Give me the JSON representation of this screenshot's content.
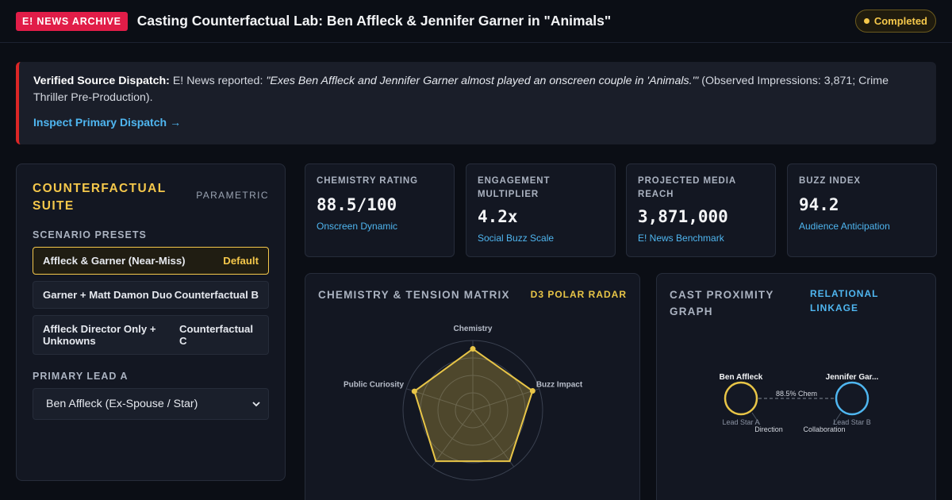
{
  "header": {
    "badge": "E! NEWS ARCHIVE",
    "title": "Casting Counterfactual Lab: Ben Affleck & Jennifer Garner in \"Animals\"",
    "status": "Completed"
  },
  "dispatch": {
    "label": "Verified Source Dispatch:",
    "lead": "E! News reported:",
    "quote": "\"Exes Ben Affleck and Jennifer Garner almost played an onscreen couple in 'Animals.'\"",
    "tail": "(Observed Impressions: 3,871; Crime Thriller Pre-Production).",
    "link_label": "Inspect Primary Dispatch",
    "link_arrow": "→"
  },
  "suite": {
    "title": "COUNTERFACTUAL SUITE",
    "tag": "PARAMETRIC",
    "presets_label": "SCENARIO PRESETS",
    "presets": [
      {
        "name": "Affleck & Garner (Near-Miss)",
        "tag": "Default",
        "active": true
      },
      {
        "name": "Garner + Matt Damon Duo",
        "tag": "Counterfactual B",
        "active": false
      },
      {
        "name": "Affleck Director Only + Unknowns",
        "tag": "Counterfactual C",
        "active": false
      }
    ],
    "lead_label": "PRIMARY LEAD A",
    "lead_value": "Ben Affleck (Ex-Spouse / Star)"
  },
  "kpis": [
    {
      "label": "CHEMISTRY RATING",
      "value": "88.5/100",
      "sub": "Onscreen Dynamic"
    },
    {
      "label": "ENGAGEMENT MULTIPLIER",
      "value": "4.2x",
      "sub": "Social Buzz Scale"
    },
    {
      "label": "PROJECTED MEDIA REACH",
      "value": "3,871,000",
      "sub": "E! News Benchmark"
    },
    {
      "label": "BUZZ INDEX",
      "value": "94.2",
      "sub": "Audience Anticipation"
    }
  ],
  "radar": {
    "title": "CHEMISTRY & TENSION MATRIX",
    "tag": "D3 POLAR RADAR",
    "accent": "#e8c547"
  },
  "graph": {
    "title": "CAST PROXIMITY GRAPH",
    "tag": "RELATIONAL LINKAGE",
    "accent": "#4fb6f0"
  },
  "chart_data": {
    "type": "radar",
    "axes": [
      "Chemistry",
      "Buzz Impact",
      "Public Curiosity"
    ],
    "values": [
      0.88,
      0.9,
      0.88
    ]
  },
  "cast_graph": {
    "nodes": [
      {
        "name": "Ben Affleck",
        "role": "Lead Star A",
        "color": "#e8c547"
      },
      {
        "name": "Jennifer Gar...",
        "role": "Lead Star B",
        "color": "#4fb6f0"
      }
    ],
    "link_label": "88.5% Chem",
    "secondary_labels": [
      "Direction",
      "Collaboration"
    ]
  }
}
